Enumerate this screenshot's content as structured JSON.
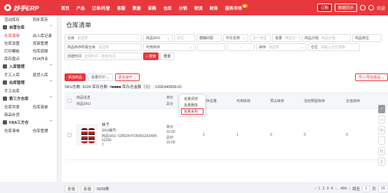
{
  "topbar": {
    "logo": "妙手ERP",
    "nav": [
      "首页",
      "产品",
      "订单/托管",
      "客服",
      "数据",
      "采购",
      "仓库",
      "分销",
      "物流",
      "财务",
      "服务市场"
    ],
    "badge": "新",
    "order_btn": "订购",
    "sync_btn": "数据同步",
    "greeting": "欢迎"
  },
  "sidebar": {
    "top_row": [
      "活动库存",
      "同步库存"
    ],
    "sections": [
      {
        "title": "自营仓库",
        "rows": [
          [
            "仓库清单",
            "出入库记录"
          ],
          [
            "仓库设置",
            "货架管理"
          ],
          [
            "打印模板",
            "仓库调拨"
          ],
          [
            "库存盘点",
            "PDA作业"
          ]
        ]
      },
      {
        "title": "入库管理",
        "rows": [
          [
            "手工入库",
            "退货入库"
          ]
        ]
      },
      {
        "title": "出库管理",
        "rows": [
          [
            "手工出库",
            ""
          ]
        ]
      },
      {
        "title": "第三方仓库",
        "rows": [
          [
            "仓库列表",
            "仓库清单"
          ],
          [
            "商品补货",
            ""
          ]
        ]
      },
      {
        "title": "FBA三方仓",
        "rows": [
          [
            "仓库清单",
            "仓库管理"
          ]
        ]
      }
    ]
  },
  "main": {
    "title": "仓库清单",
    "filters": {
      "warehouse_label": "仓库",
      "warehouse_ph": "请选择",
      "sku_label": "商品SKU",
      "sku_mode": "双过",
      "sku_match": "模糊匹配",
      "name_label": "中文名称",
      "name_ph": "多个用逗",
      "batch": "批量",
      "multi_select": "筛选任一",
      "product_cat": "商品分组",
      "product_cat_ph": "商品分组",
      "storage_label": "商品库位",
      "owner_label": "商品库存所属仓库",
      "owner_ph": "请选择",
      "stock_label": "可用库存",
      "range_sep": "-",
      "alert_label": "库存",
      "alert_ph": "请选择",
      "tag_label": "仓位",
      "tag_ph": "请输入仓位搜索",
      "time_label": "创建时间",
      "time_ph": "选择时间 - 结束时间",
      "search_btn": "搜索",
      "reset_btn": "重置"
    },
    "actions": {
      "add": "添加商品",
      "batch_print": "批量打印",
      "more": "更多操作",
      "import_export": "导入/导出商品"
    },
    "dropdown": [
      "批量调增",
      "批量删除",
      "批量采购"
    ],
    "summary": "SKU总数: 9109  库存总数: 4■■■■  库存总金额（元）: 1206340959.01",
    "columns": {
      "c1a": "商品信息",
      "c1b": "商品SKU",
      "c2a": "单价",
      "c2b": "总价",
      "c3": "库存总量",
      "c4": "可用库存",
      "c5": "预占库存",
      "c6": "活动预留库存",
      "c7": "在途库存"
    },
    "row": {
      "name": "袜子",
      "sku_line": "SKU编号:",
      "code_line": "商品SKU: 535524-P230901162408-52265",
      "code_line2": "7",
      "unit_label": "单价:",
      "unit_val": "10.00",
      "total_label": "总价:",
      "total_val": "10.00",
      "qty_total": "1",
      "qty_avail": "1",
      "qty_pre": "0",
      "qty_act": "0",
      "qty_transit": "0"
    },
    "footer": {
      "select_all": "全选",
      "invert": "反选",
      "count": "9109条",
      "pages": [
        "1",
        "2",
        "3",
        "4",
        "...",
        "456"
      ],
      "goto": "跳至",
      "page_input": "1",
      "page_unit": "页",
      "page_size": "20"
    }
  },
  "accent": "#e8383d"
}
